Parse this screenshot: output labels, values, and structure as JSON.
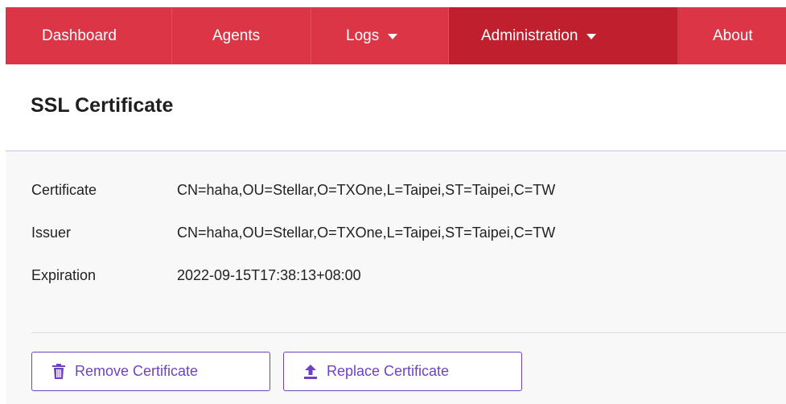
{
  "nav": {
    "items": [
      {
        "label": "Dashboard"
      },
      {
        "label": "Agents"
      },
      {
        "label": "Logs"
      },
      {
        "label": "Administration"
      },
      {
        "label": "About"
      }
    ]
  },
  "page": {
    "title": "SSL Certificate"
  },
  "certificate": {
    "rows": [
      {
        "label": "Certificate",
        "value": "CN=haha,OU=Stellar,O=TXOne,L=Taipei,ST=Taipei,C=TW"
      },
      {
        "label": "Issuer",
        "value": "CN=haha,OU=Stellar,O=TXOne,L=Taipei,ST=Taipei,C=TW"
      },
      {
        "label": "Expiration",
        "value": "2022-09-15T17:38:13+08:00"
      }
    ]
  },
  "actions": {
    "remove_label": "Remove Certificate",
    "remove_icon": "trash-icon",
    "replace_label": "Replace Certificate",
    "replace_icon": "upload-icon"
  },
  "colors": {
    "navbar": "#dc3545",
    "navbar_active": "#c0202e",
    "accent": "#6f42c1"
  }
}
